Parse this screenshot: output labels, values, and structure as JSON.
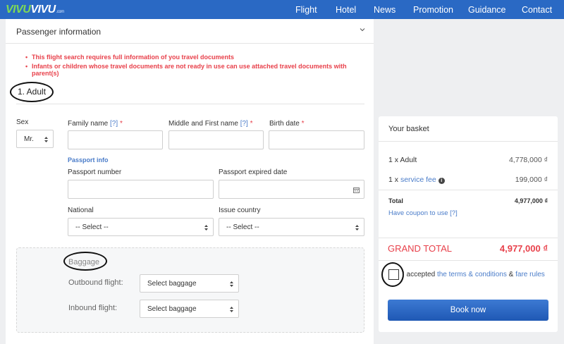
{
  "brand": {
    "logo_part1": "VIVU",
    "logo_part2": "VIVU",
    "logo_domain": ".com"
  },
  "nav": {
    "items": [
      "Flight",
      "Hotel",
      "News",
      "Promotion",
      "Guidance",
      "Contact"
    ]
  },
  "passenger": {
    "title": "Passenger information",
    "warnings": [
      "This flight search requires full information of you travel documents",
      "Infants or children whose travel documents are not ready in use can use attached travel documents with parent(s)"
    ],
    "section_title": "1. Adult",
    "sex_label": "Sex",
    "sex_value": "Mr.",
    "family_name_label": "Family name",
    "middle_first_label": "Middle and First name",
    "birth_date_label": "Birth date",
    "help_link": "[?]",
    "required_mark": "*",
    "passport_info": "Passport info",
    "passport_number_label": "Passport number",
    "passport_expired_label": "Passport expired date",
    "national_label": "National",
    "national_value": "-- Select --",
    "issue_country_label": "Issue country",
    "issue_country_value": "-- Select --"
  },
  "baggage": {
    "title": "Baggage",
    "outbound_label": "Outbound flight:",
    "outbound_value": "Select baggage",
    "inbound_label": "Inbound flight:",
    "inbound_value": "Select baggage"
  },
  "basket": {
    "title": "Your basket",
    "adult_label": "1 x Adult",
    "adult_price": "4,778,000 ₫",
    "fee_prefix": "1 x",
    "fee_link": "service fee",
    "fee_price": "199,000 ₫",
    "total_label": "Total",
    "total_value": "4,977,000 ₫",
    "coupon": "Have coupon to use [?]",
    "grand_total_label": "GRAND TOTAL",
    "grand_total_value": "4,977,000 ₫",
    "accept_prefix": "I accepted",
    "terms_link": "the terms & conditions",
    "accept_amp": "&",
    "fare_link": "fare rules",
    "book_button": "Book now"
  },
  "colors": {
    "nav_bg": "#2a69c4",
    "accent_red": "#e8414b",
    "link_blue": "#4a7cc9",
    "button_blue": "#2a65c0"
  }
}
